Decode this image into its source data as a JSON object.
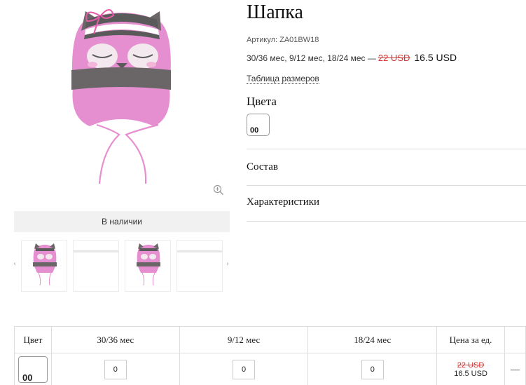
{
  "product": {
    "title": "Шапка",
    "sku": "Артикул: ZA01BW18",
    "sizes_text": "30/36 мес, 9/12 мес, 18/24 мес —",
    "old_price": "22 USD",
    "new_price": "16.5 USD",
    "size_table_link": "Таблица размеров",
    "colors_heading": "Цвета",
    "color_code": "00",
    "sections": [
      "Состав",
      "Характеристики"
    ],
    "stock_status": "В наличии"
  },
  "colors": {
    "hat_pink": "#e58fd0",
    "hat_gray": "#6a6668",
    "price_strike": "#d23232"
  },
  "table": {
    "headers": [
      "Цвет",
      "30/36 мес",
      "9/12 мес",
      "18/24 мес",
      "Цена за ед.",
      ""
    ],
    "row": {
      "color_code": "00",
      "qty": [
        "0",
        "0",
        "0"
      ],
      "old_price": "22 USD",
      "new_price": "16.5 USD",
      "extra": "—"
    }
  },
  "icons": {
    "zoom": "zoom-in-icon",
    "prev": "chevron-left-icon",
    "next": "chevron-right-icon"
  }
}
